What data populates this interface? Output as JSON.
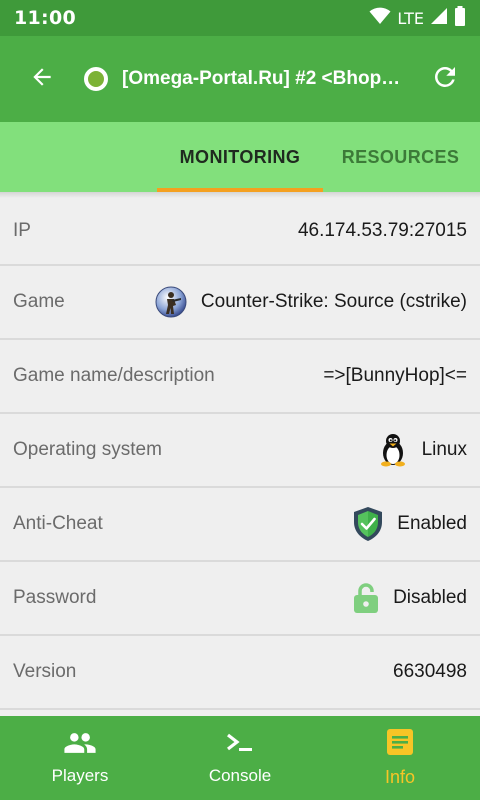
{
  "status_bar": {
    "time": "11:00",
    "network": "LTE"
  },
  "app_bar": {
    "title": "[Omega-Portal.Ru] #2 <Bhop>..."
  },
  "tabs": [
    {
      "label": "MONITORING",
      "active": true
    },
    {
      "label": "RESOURCES",
      "active": false
    }
  ],
  "rows": [
    {
      "label": "IP",
      "value": "46.174.53.79:27015"
    },
    {
      "label": "Game",
      "value": "Counter-Strike: Source (cstrike)",
      "icon": "cstrike-icon"
    },
    {
      "label": "Game name/description",
      "value": "=>[BunnyHop]<="
    },
    {
      "label": "Operating system",
      "value": "Linux",
      "icon": "linux-penguin-icon"
    },
    {
      "label": "Anti-Cheat",
      "value": "Enabled",
      "icon": "shield-check-icon"
    },
    {
      "label": "Password",
      "value": "Disabled",
      "icon": "unlocked-icon"
    },
    {
      "label": "Version",
      "value": "6630498"
    }
  ],
  "bottom_nav": [
    {
      "label": "Players",
      "icon": "people-icon"
    },
    {
      "label": "Console",
      "icon": "terminal-icon"
    },
    {
      "label": "Info",
      "icon": "info-list-icon",
      "active": true
    }
  ],
  "colors": {
    "primary": "#4cae46",
    "status_bar": "#3f9a3a",
    "tabs_bg": "#82e07c",
    "accent": "#f4a020",
    "active_nav": "#f7c526"
  }
}
